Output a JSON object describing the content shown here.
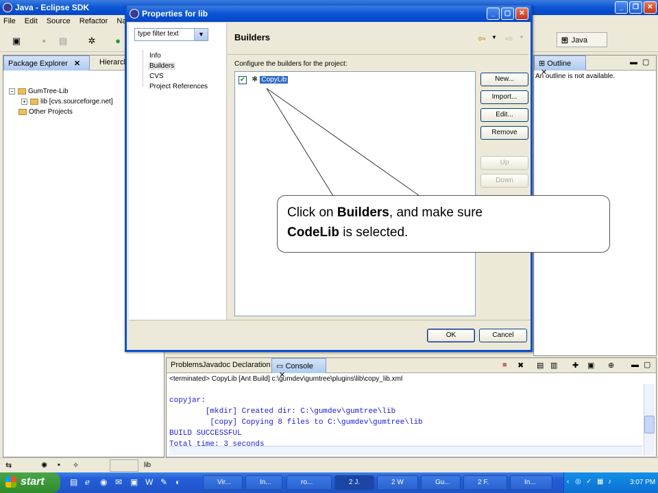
{
  "main_window": {
    "title": "Java - Eclipse SDK",
    "menu": [
      "File",
      "Edit",
      "Source",
      "Refactor",
      "Naviga"
    ],
    "perspective": "Java"
  },
  "package_explorer": {
    "tabs": [
      "Package Explorer",
      "Hierarch"
    ],
    "tree": [
      {
        "label": "GumTree-Lib",
        "expander": "−"
      },
      {
        "label": "lib  [cvs.sourceforge.net]",
        "expander": "+"
      },
      {
        "label": "Other Projects",
        "expander": ""
      }
    ]
  },
  "outline": {
    "tab": "Outline",
    "message": "An outline is not available."
  },
  "dialog": {
    "title": "Properties for lib",
    "filter_value": "type filter text",
    "nav": [
      "Info",
      "Builders",
      "CVS",
      "Project References"
    ],
    "selected_nav": "Builders",
    "page_title": "Builders",
    "config_label": "Configure the builders for the project:",
    "builders": [
      {
        "name": "CopyLib",
        "checked": true
      }
    ],
    "buttons": {
      "new": "New...",
      "import": "Import...",
      "edit": "Edit...",
      "remove": "Remove",
      "up": "Up",
      "down": "Down"
    },
    "ok": "OK",
    "cancel": "Cancel"
  },
  "callout": {
    "part1": "Click on ",
    "bold1": "Builders",
    "part2": ", and make sure",
    "bold2": "CodeLib",
    "part3": " is selected."
  },
  "console": {
    "tabs": [
      "Problems",
      "Javadoc",
      "Declaration",
      "Console"
    ],
    "header": "<terminated> CopyLib [Ant Build] c:\\gumdev\\gumtree\\plugins\\lib\\copy_lib.xml",
    "lines": [
      "copyjar:",
      "        [mkdir] Created dir: C:\\gumdev\\gumtree\\lib",
      "         [copy] Copying 8 files to C:\\gumdev\\gumtree\\lib",
      "BUILD SUCCESSFUL",
      "Total time: 3 seconds"
    ]
  },
  "status": {
    "text": "lib"
  },
  "taskbar": {
    "start": "start",
    "tasks": [
      "Vir...",
      "In...",
      "ro...",
      "2 J.",
      "2 W",
      "Gu...",
      "2 F.",
      "In..."
    ],
    "clock": "3:07 PM"
  }
}
